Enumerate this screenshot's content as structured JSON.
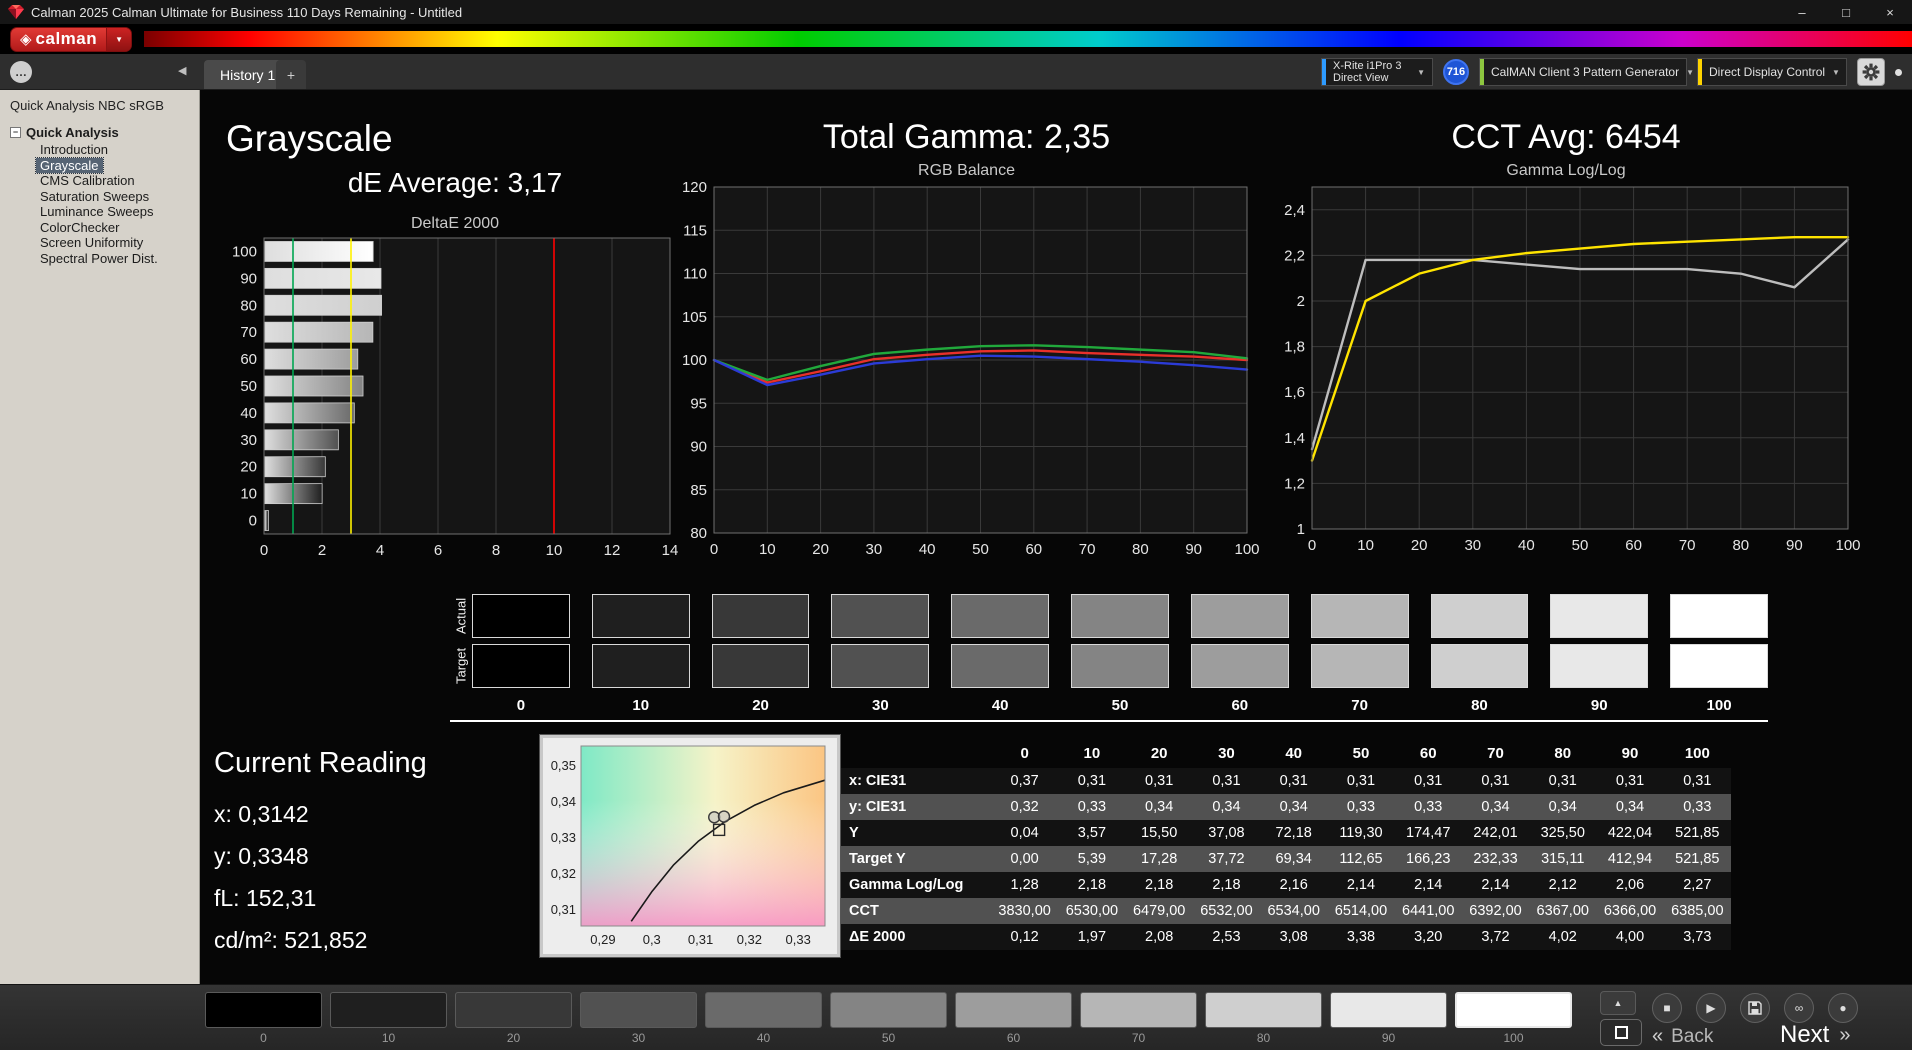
{
  "window": {
    "title": "Calman 2025 Calman Ultimate for Business 110 Days Remaining - Untitled",
    "controls": {
      "minimize": "–",
      "restore": "□",
      "close": "×"
    }
  },
  "logo": {
    "brand": "calman"
  },
  "tabs": {
    "active": "History 1",
    "add": "+"
  },
  "toolbar": {
    "meter": {
      "line1": "X-Rite i1Pro 3",
      "line2": "Direct View",
      "accent": "#2e9bff"
    },
    "badge": {
      "text": "716",
      "color": "#1f55d6"
    },
    "pattern_generator": {
      "label": "CalMAN Client 3 Pattern Generator",
      "accent": "#8dc63f"
    },
    "display_control": {
      "label": "Direct Display Control",
      "accent": "#ffd400"
    }
  },
  "sidebar": {
    "header": "Quick Analysis NBC sRGB",
    "root": "Quick Analysis",
    "items": [
      "Introduction",
      "Grayscale",
      "CMS Calibration",
      "Saturation Sweeps",
      "Luminance Sweeps",
      "ColorChecker",
      "Screen Uniformity",
      "Spectral Power Dist."
    ],
    "selected_index": 1
  },
  "headers": {
    "grayscale": "Grayscale",
    "de_average": "dE Average: 3,17",
    "total_gamma": "Total Gamma: 2,35",
    "cct_avg": "CCT Avg: 6454"
  },
  "chart_data": [
    {
      "type": "bar",
      "orientation": "horizontal",
      "title": "DeltaE 2000",
      "categories": [
        "100",
        "90",
        "80",
        "70",
        "60",
        "50",
        "40",
        "30",
        "20",
        "10",
        "0"
      ],
      "values": [
        3.73,
        4.0,
        4.02,
        3.72,
        3.2,
        3.38,
        3.08,
        2.53,
        2.08,
        1.97,
        0.12
      ],
      "xlim": [
        0,
        14
      ],
      "x_ticks": [
        0,
        2,
        4,
        6,
        8,
        10,
        12,
        14
      ],
      "reference_lines": [
        {
          "value": 1,
          "color": "#00a651"
        },
        {
          "value": 3,
          "color": "#fff200"
        },
        {
          "value": 10,
          "color": "#ff0000"
        }
      ]
    },
    {
      "type": "line",
      "title": "RGB Balance",
      "x": [
        0,
        10,
        20,
        30,
        40,
        50,
        60,
        70,
        80,
        90,
        100
      ],
      "x_ticks": [
        0,
        10,
        20,
        30,
        40,
        50,
        60,
        70,
        80,
        90,
        100
      ],
      "ylim": [
        80,
        120
      ],
      "y_ticks": [
        80,
        85,
        90,
        95,
        100,
        105,
        110,
        115,
        120
      ],
      "series": [
        {
          "name": "Red",
          "color": "#e8302a",
          "values": [
            100.0,
            97.4,
            98.7,
            100.1,
            100.6,
            101.0,
            101.1,
            100.8,
            100.6,
            100.4,
            100.0
          ]
        },
        {
          "name": "Green",
          "color": "#21a93c",
          "values": [
            100.0,
            97.7,
            99.3,
            100.7,
            101.2,
            101.6,
            101.7,
            101.5,
            101.2,
            100.9,
            100.2
          ]
        },
        {
          "name": "Blue",
          "color": "#2b3bd6",
          "values": [
            100.0,
            97.1,
            98.3,
            99.6,
            100.1,
            100.5,
            100.4,
            100.1,
            99.8,
            99.4,
            98.9
          ]
        }
      ]
    },
    {
      "type": "line",
      "title": "Gamma Log/Log",
      "x": [
        0,
        10,
        20,
        30,
        40,
        50,
        60,
        70,
        80,
        90,
        100
      ],
      "x_ticks": [
        0,
        10,
        20,
        30,
        40,
        50,
        60,
        70,
        80,
        90,
        100
      ],
      "ylim": [
        1,
        2.5
      ],
      "y_ticks": [
        1,
        1.2,
        1.4,
        1.6,
        1.8,
        2,
        2.2,
        2.4
      ],
      "y_tick_labels": [
        "1",
        "1,2",
        "1,4",
        "1,6",
        "1,8",
        "2",
        "2,2",
        "2,4"
      ],
      "series": [
        {
          "name": "Measured",
          "color": "#bdbdbd",
          "values": [
            1.35,
            2.18,
            2.18,
            2.18,
            2.16,
            2.14,
            2.14,
            2.14,
            2.12,
            2.06,
            2.27
          ]
        },
        {
          "name": "Target",
          "color": "#ffe400",
          "values": [
            1.3,
            2.0,
            2.12,
            2.18,
            2.21,
            2.23,
            2.25,
            2.26,
            2.27,
            2.28,
            2.28
          ]
        }
      ]
    }
  ],
  "strip": {
    "row_labels": [
      "Actual",
      "Target"
    ],
    "levels": [
      "0",
      "10",
      "20",
      "30",
      "40",
      "50",
      "60",
      "70",
      "80",
      "90",
      "100"
    ]
  },
  "current_reading": {
    "title": "Current Reading",
    "x": "x: 0,3142",
    "y": "y: 0,3348",
    "fl": "fL: 152,31",
    "cd": "cd/m²: 521,852"
  },
  "cie_plot": {
    "xlim": [
      0.2855,
      0.3355
    ],
    "ylim": [
      0.3055,
      0.3555
    ],
    "x_tick_values": [
      0.29,
      0.3,
      0.31,
      0.32,
      0.33
    ],
    "x_tick_labels": [
      "0,29",
      "0,3",
      "0,31",
      "0,32",
      "0,33"
    ],
    "y_tick_values": [
      0.31,
      0.32,
      0.33,
      0.34,
      0.35
    ],
    "y_tick_labels": [
      "0,31",
      "0,32",
      "0,33",
      "0,34",
      "0,35"
    ],
    "locus": [
      [
        0.2958,
        0.3068
      ],
      [
        0.3,
        0.315
      ],
      [
        0.3045,
        0.3225
      ],
      [
        0.3095,
        0.329
      ],
      [
        0.315,
        0.3345
      ],
      [
        0.321,
        0.339
      ],
      [
        0.327,
        0.3425
      ],
      [
        0.3355,
        0.346
      ]
    ],
    "markers": [
      {
        "shape": "circle",
        "x": 0.3128,
        "y": 0.3357
      },
      {
        "shape": "circle",
        "x": 0.3148,
        "y": 0.3359
      },
      {
        "shape": "square",
        "x": 0.3138,
        "y": 0.3322
      }
    ]
  },
  "table": {
    "columns": [
      "0",
      "10",
      "20",
      "30",
      "40",
      "50",
      "60",
      "70",
      "80",
      "90",
      "100"
    ],
    "rows": [
      {
        "label": "x: CIE31",
        "values": [
          "0,37",
          "0,31",
          "0,31",
          "0,31",
          "0,31",
          "0,31",
          "0,31",
          "0,31",
          "0,31",
          "0,31",
          "0,31"
        ]
      },
      {
        "label": "y: CIE31",
        "values": [
          "0,32",
          "0,33",
          "0,34",
          "0,34",
          "0,34",
          "0,33",
          "0,33",
          "0,34",
          "0,34",
          "0,34",
          "0,33"
        ]
      },
      {
        "label": "Y",
        "values": [
          "0,04",
          "3,57",
          "15,50",
          "37,08",
          "72,18",
          "119,30",
          "174,47",
          "242,01",
          "325,50",
          "422,04",
          "521,85"
        ]
      },
      {
        "label": "Target Y",
        "values": [
          "0,00",
          "5,39",
          "17,28",
          "37,72",
          "69,34",
          "112,65",
          "166,23",
          "232,33",
          "315,11",
          "412,94",
          "521,85"
        ]
      },
      {
        "label": "Gamma Log/Log",
        "values": [
          "1,28",
          "2,18",
          "2,18",
          "2,18",
          "2,16",
          "2,14",
          "2,14",
          "2,14",
          "2,12",
          "2,06",
          "2,27"
        ]
      },
      {
        "label": "CCT",
        "values": [
          "3830,00",
          "6530,00",
          "6479,00",
          "6532,00",
          "6534,00",
          "6514,00",
          "6441,00",
          "6392,00",
          "6367,00",
          "6366,00",
          "6385,00"
        ]
      },
      {
        "label": "ΔE 2000",
        "values": [
          "0,12",
          "1,97",
          "2,08",
          "2,53",
          "3,08",
          "3,38",
          "3,20",
          "3,72",
          "4,02",
          "4,00",
          "3,73"
        ]
      }
    ]
  },
  "bottombar": {
    "levels": [
      "0",
      "10",
      "20",
      "30",
      "40",
      "50",
      "60",
      "70",
      "80",
      "90",
      "100"
    ],
    "selected_index": 10,
    "back": "Back",
    "next": "Next"
  },
  "colors": {
    "gray_ramp": [
      "#000000",
      "#1f1f1f",
      "#383838",
      "#515151",
      "#6a6a6a",
      "#848484",
      "#9d9d9d",
      "#b6b6b6",
      "#cfcfcf",
      "#e8e8e8",
      "#ffffff"
    ]
  },
  "icons": {
    "caret_down": "▼",
    "gem": "◈",
    "collapse_left": "◀",
    "ellipsis": "…",
    "tree_collapse": "−",
    "up_small": "▲",
    "stop": "■",
    "play": "▶",
    "infinity": "∞",
    "record": "●",
    "chevrons_left": "«",
    "chevrons_right": "»"
  }
}
